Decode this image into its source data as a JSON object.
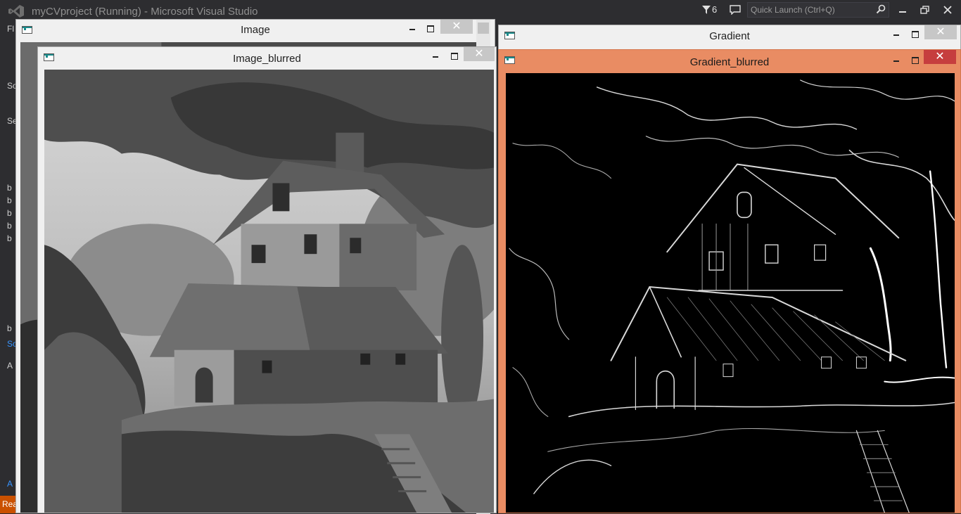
{
  "vs": {
    "title": "myCVproject (Running) - Microsoft Visual Studio",
    "notification_count": "6",
    "quick_launch_placeholder": "Quick Launch (Ctrl+Q)",
    "left_fragments": [
      "Fl",
      "So",
      "Se",
      "b",
      "b",
      "b",
      "b",
      "b",
      "b",
      "So",
      "A",
      "A"
    ],
    "status_text": "Rea"
  },
  "windows": {
    "image": {
      "title": "Image",
      "close": "✕"
    },
    "gradient": {
      "title": "Gradient",
      "close": "✕"
    },
    "image_blurred": {
      "title": "Image_blurred",
      "close": "✕"
    },
    "gradient_blurred": {
      "title": "Gradient_blurred",
      "close": "✕"
    }
  },
  "colors": {
    "vs_chrome": "#2d2d30",
    "status_orange": "#ca5100",
    "active_caption": "#e98c63",
    "close_red": "#c63e3e"
  }
}
